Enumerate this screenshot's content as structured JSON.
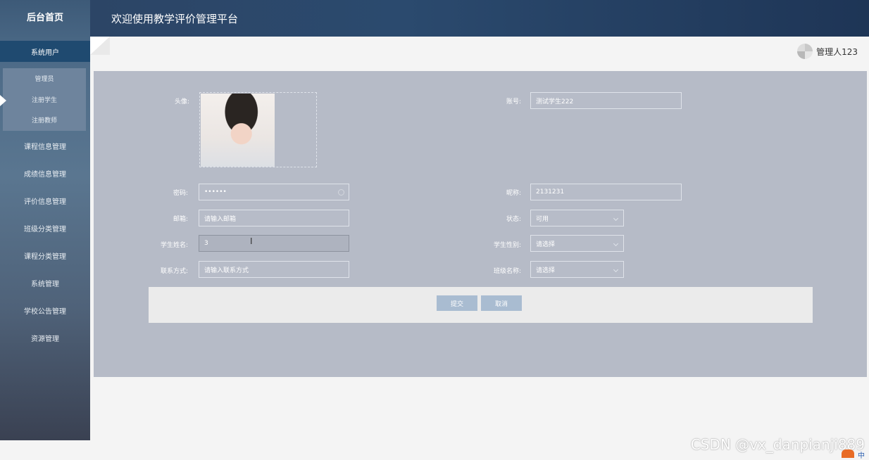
{
  "sidebar": {
    "home": "后台首页",
    "active_group": "系统用户",
    "sub_items": [
      "管理员",
      "注册学生",
      "注册教师"
    ],
    "items": [
      "课程信息管理",
      "成绩信息管理",
      "评价信息管理",
      "班级分类管理",
      "课程分类管理",
      "系统管理",
      "学校公告管理",
      "资源管理"
    ]
  },
  "header": {
    "title": "欢迎使用教学评价管理平台"
  },
  "user": {
    "name": "管理人123"
  },
  "form": {
    "avatar_label": "头像:",
    "account_label": "账号:",
    "account_value": "测试学生222",
    "password_label": "密码:",
    "password_value": "••••••",
    "nickname_label": "昵称:",
    "nickname_value": "2131231",
    "email_label": "邮箱:",
    "email_placeholder": "请输入邮箱",
    "status_label": "状态:",
    "status_value": "可用",
    "student_name_label": "学生姓名:",
    "student_name_value": "3",
    "gender_label": "学生性别:",
    "gender_value": "请选择",
    "contact_label": "联系方式:",
    "contact_placeholder": "请输入联系方式",
    "class_label": "班级名称:",
    "class_value": "请选择",
    "submit": "提交",
    "cancel": "取消"
  },
  "watermark": "CSDN @vx_danpianji889",
  "tray": {
    "lang": "中"
  }
}
